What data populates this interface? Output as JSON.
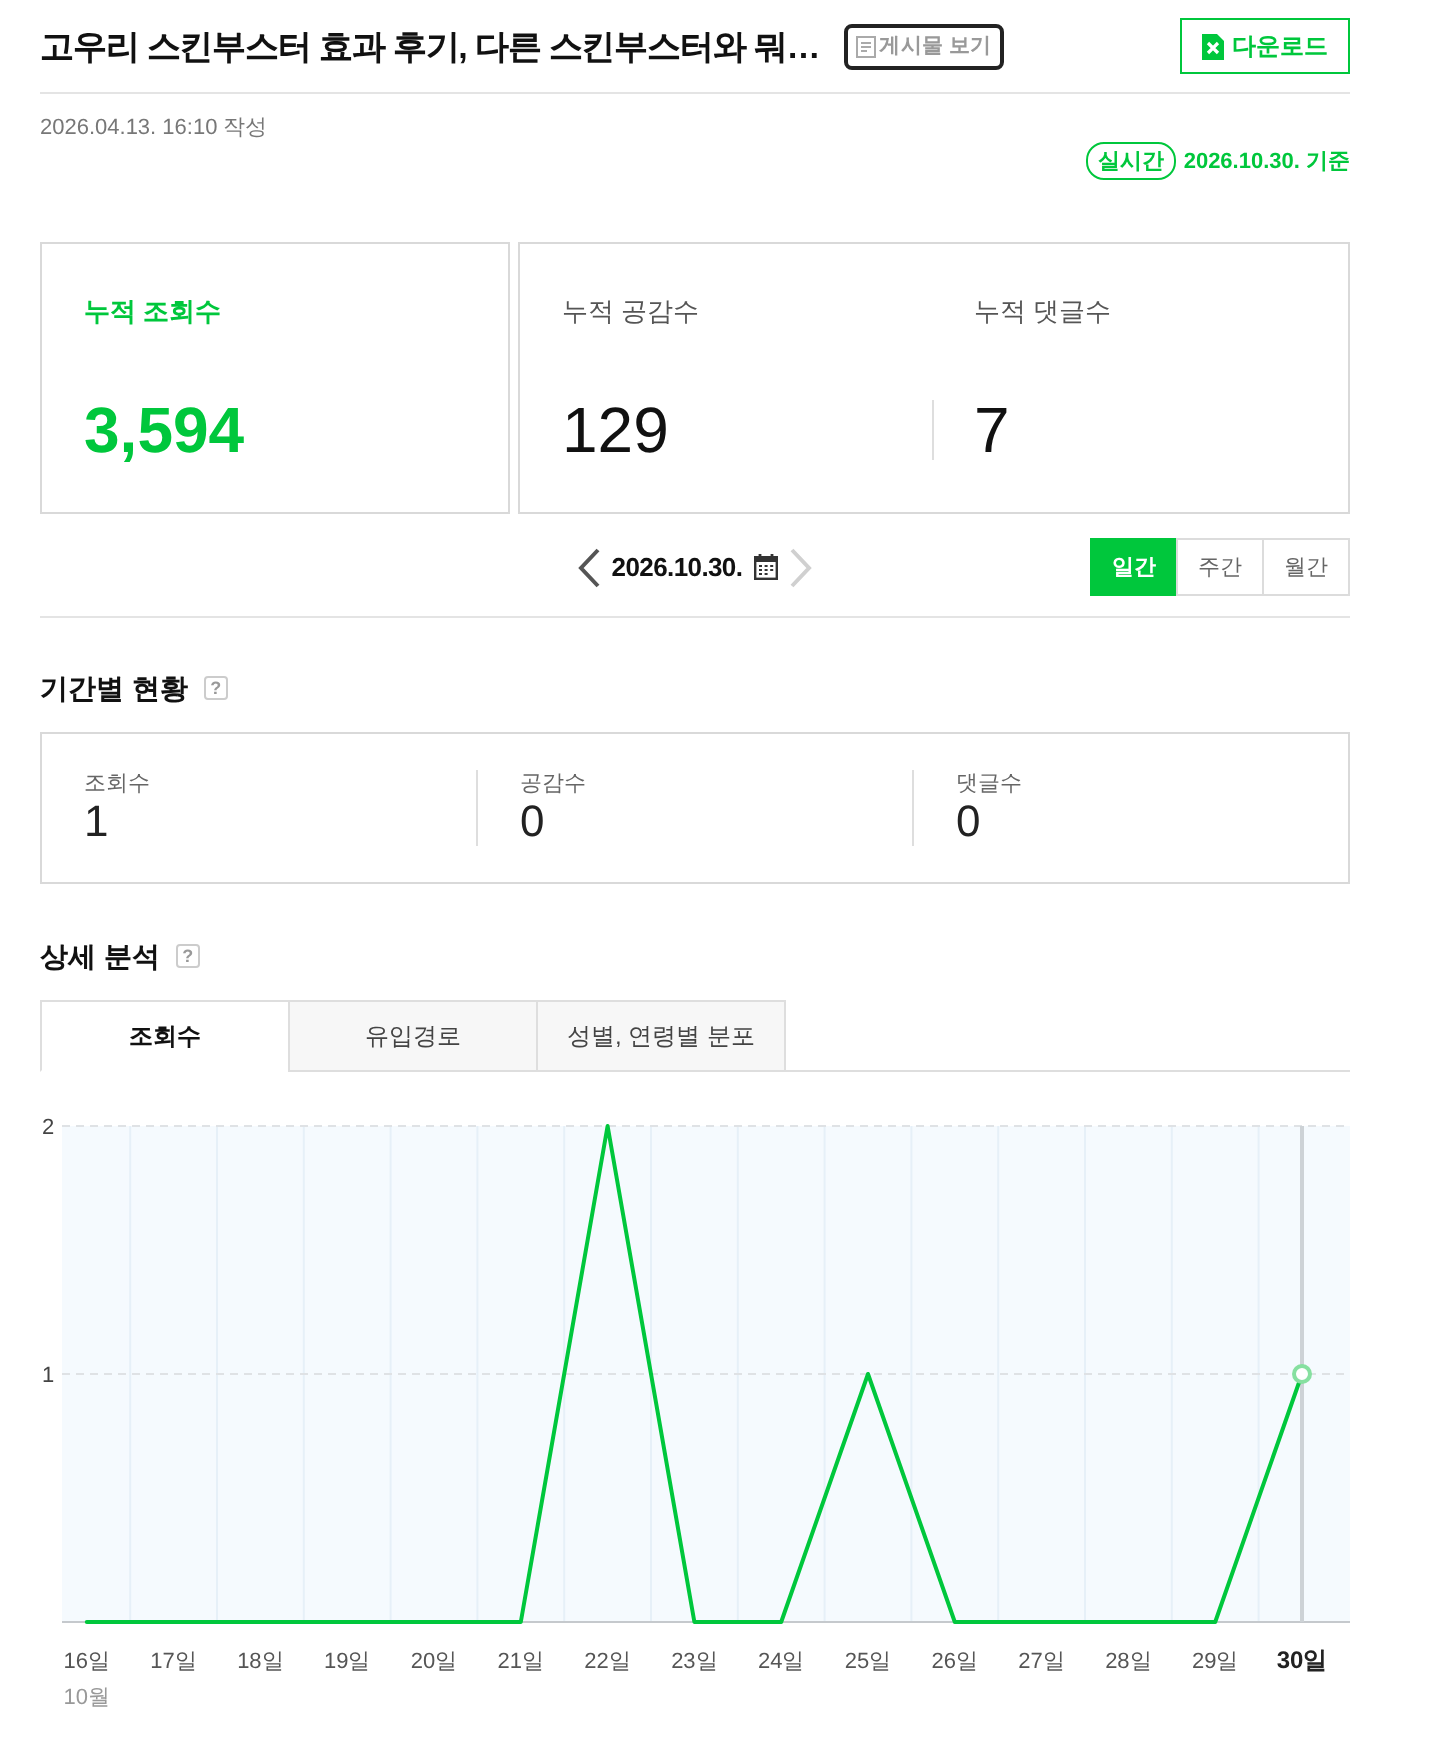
{
  "header": {
    "title": "고우리 스킨부스터 효과 후기, 다른 스킨부스터와 뭐…",
    "view_post_button": "게시물 보기",
    "download_button": "다운로드"
  },
  "meta": {
    "written": "2026.04.13. 16:10 작성",
    "realtime_badge": "실시간",
    "reference_date": "2026.10.30. 기준"
  },
  "totals": [
    {
      "kind": "primary",
      "label": "누적 조회수",
      "value": "3,594"
    },
    {
      "kind": "secondary",
      "label": "누적 공감수",
      "value": "129"
    },
    {
      "kind": "secondary",
      "label": "누적 댓글수",
      "value": "7"
    }
  ],
  "date_nav": {
    "date": "2026.10.30.",
    "prev_disabled": false,
    "next_disabled": true
  },
  "periods": [
    {
      "label": "일간",
      "selected": true
    },
    {
      "label": "주간",
      "selected": false
    },
    {
      "label": "월간",
      "selected": false
    }
  ],
  "period_status": {
    "title": "기간별 현황",
    "help": "?",
    "items": [
      {
        "label": "조회수",
        "value": "1"
      },
      {
        "label": "공감수",
        "value": "0"
      },
      {
        "label": "댓글수",
        "value": "0"
      }
    ]
  },
  "detail_analysis": {
    "title": "상세 분석",
    "help": "?",
    "tabs": [
      {
        "label": "조회수",
        "selected": true
      },
      {
        "label": "유입경로",
        "selected": false
      },
      {
        "label": "성별, 연령별 분포",
        "selected": false
      }
    ],
    "chart": {
      "month_label": "10월",
      "chart_data": {
        "type": "line",
        "categories": [
          "16일",
          "17일",
          "18일",
          "19일",
          "20일",
          "21일",
          "22일",
          "23일",
          "24일",
          "25일",
          "26일",
          "27일",
          "28일",
          "29일",
          "30일"
        ],
        "series": [
          {
            "color": "#00c73c",
            "values": [
              0,
              0,
              0,
              0,
              0,
              0,
              2,
              0,
              0,
              1,
              0,
              0,
              0,
              0,
              1
            ]
          }
        ],
        "ylim": [
          0,
          2
        ],
        "yticks": [
          1,
          2
        ],
        "ref_lines": [
          {
            "axis": "y",
            "value": 1
          },
          {
            "axis": "y",
            "value": 2
          },
          {
            "axis": "x",
            "value": "30일"
          }
        ]
      }
    }
  }
}
